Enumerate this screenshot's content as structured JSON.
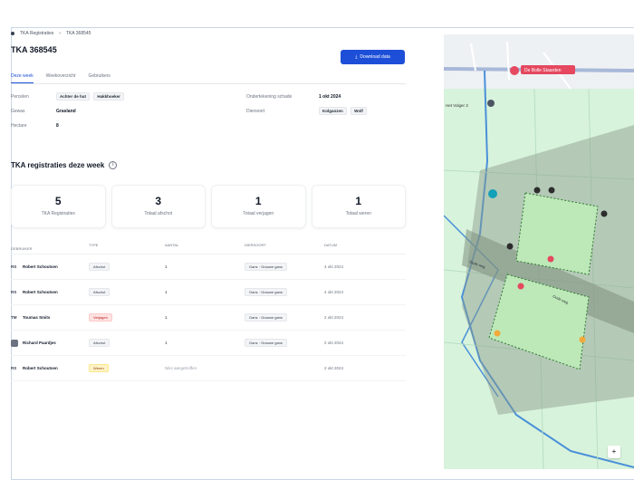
{
  "breadcrumb": {
    "root": "TKA Registraties",
    "separator": "›",
    "current": "TKA 368545"
  },
  "page": {
    "title": "TKA 368545"
  },
  "download_button": {
    "label": "Download data",
    "icon": "download-icon"
  },
  "tabs": [
    {
      "label": "Deze week",
      "active": true
    },
    {
      "label": "Weekoverzicht",
      "active": false
    },
    {
      "label": "Gebruikers",
      "active": false
    }
  ],
  "properties": {
    "percelen": {
      "key": "Percelen",
      "chips": [
        "Achter de hut",
        "Hakkhoeker"
      ]
    },
    "gewas": {
      "key": "Gewas",
      "value": "Grasland"
    },
    "hectare": {
      "key": "Hectare",
      "value": "8"
    },
    "ondertekening": {
      "key": "Ondertekening schade",
      "value": "1 okt 2024"
    },
    "diersoort": {
      "key": "Diersoort",
      "chips": [
        "Kolganzen",
        "Wolf"
      ]
    }
  },
  "section": {
    "title": "TKA registraties deze week",
    "icon": "info-icon"
  },
  "stats": [
    {
      "value": "5",
      "label": "TKA Registraties"
    },
    {
      "value": "3",
      "label": "Totaal afschot"
    },
    {
      "value": "1",
      "label": "Totaal verjagen"
    },
    {
      "value": "1",
      "label": "Totaal weren"
    }
  ],
  "table": {
    "headers": [
      "GEBRUIKER",
      "TYPE",
      "AANTAL",
      "DIERSOORT",
      "DATUM"
    ],
    "rows": [
      {
        "initials": "RS",
        "name": "Robert Schoutsen",
        "type": "Afschot",
        "type_style": "gray",
        "count": "1",
        "species": "Gans · Grauwe gans",
        "date": "4 okt 2024"
      },
      {
        "initials": "RS",
        "name": "Robert Schoutsen",
        "type": "Afschot",
        "type_style": "gray",
        "count": "1",
        "species": "Gans · Grauwe gans",
        "date": "4 okt 2024"
      },
      {
        "initials": "TM",
        "name": "Toumas Smits",
        "type": "Verjagen",
        "type_style": "red",
        "count": "1",
        "species": "Gans · Grauwe gans",
        "date": "2 okt 2024"
      },
      {
        "initials": "",
        "name": "Richard Paardjes",
        "type": "Afschot",
        "type_style": "gray",
        "count": "1",
        "species": "Gans · Grauwe gans",
        "date": "2 okt 2024"
      },
      {
        "initials": "RS",
        "name": "Robert Schoutsen",
        "type": "Weren",
        "type_style": "yellow",
        "count": "Niks aangetroffen",
        "species": "",
        "date": "2 okt 2024"
      }
    ]
  },
  "map": {
    "poi_label": "De Bolle Staarden",
    "road_label_1": "Oude weg",
    "road_label_2": "Oude weg",
    "street_label": "Het Volger 3",
    "zoom_label": "+"
  },
  "colors": {
    "accent": "#1d4ed8",
    "map_bg": "#d8f3dc",
    "field": "#bde8b8",
    "overlay": "#8a9a8a",
    "water": "#4a90d9"
  }
}
